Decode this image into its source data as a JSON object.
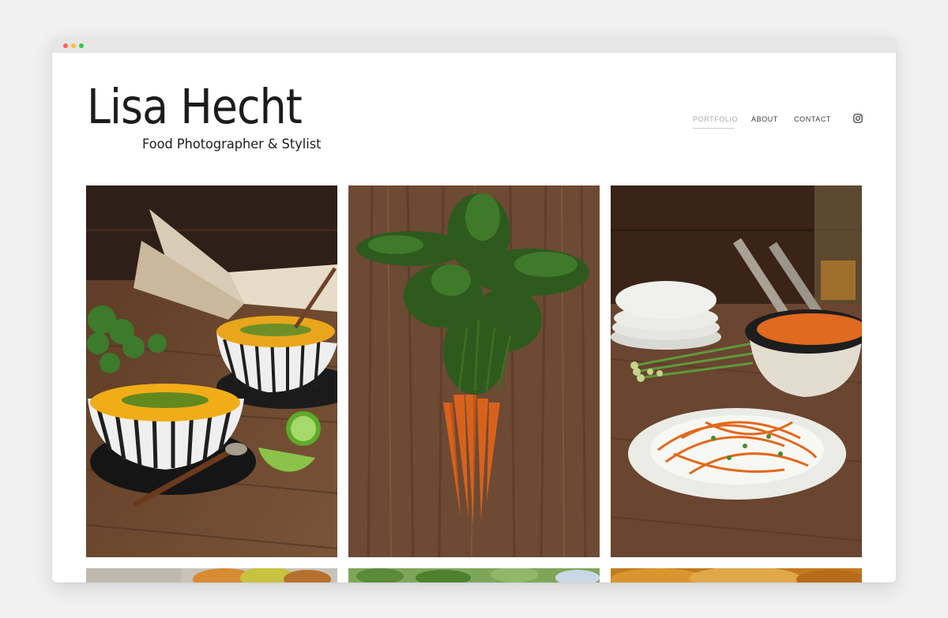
{
  "site": {
    "title": "Lisa Hecht",
    "tagline": "Food Photographer & Stylist"
  },
  "nav": {
    "items": [
      {
        "label": "PORTFOLIO",
        "active": true
      },
      {
        "label": "ABOUT",
        "active": false
      },
      {
        "label": "CONTACT",
        "active": false
      }
    ],
    "social_icon": "instagram-icon"
  },
  "portfolio": {
    "tiles": [
      {
        "subject": "pumpkin-soup-bowls-with-lime-and-open-book"
      },
      {
        "subject": "bunch-of-carrots-on-wooden-table"
      },
      {
        "subject": "carrot-salad-plate-with-serving-bowl"
      },
      {
        "subject": "apples-partial"
      },
      {
        "subject": "apple-tree-partial"
      },
      {
        "subject": "baked-goods-partial"
      }
    ]
  },
  "colors": {
    "page_bg": "#f1f1f1",
    "title_text": "#1c1c1c",
    "nav_active": "#a8a8a8",
    "nav_text": "#3a3a3a",
    "wood": "#6b4630"
  }
}
